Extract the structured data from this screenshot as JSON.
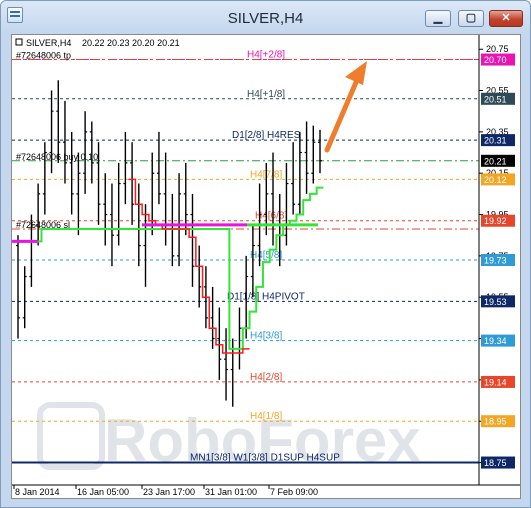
{
  "window": {
    "title": "SILVER,H4"
  },
  "chart_header": {
    "symbol": "SILVER,H4",
    "ohlc": "20.22 20.23 20.20 20.21"
  },
  "chart_data": {
    "type": "candlestick",
    "ylim": [
      18.68,
      20.78
    ],
    "y_ticks": [
      "20.75",
      "20.55",
      "20.35",
      "20.15",
      "19.95",
      "19.75",
      "19.55",
      "19.35",
      "19.15",
      "18.95",
      "18.75"
    ],
    "x_ticks": [
      "8 Jan 2014",
      "16 Jan 05:00",
      "23 Jan 17:00",
      "31 Jan 01:00",
      "7 Feb 09:00"
    ],
    "price_badges": [
      {
        "value": "20.70",
        "color": "#e815b2"
      },
      {
        "value": "20.51",
        "color": "#2e4a57"
      },
      {
        "value": "20.31",
        "color": "#0e2766"
      },
      {
        "value": "20.21",
        "color": "#000000"
      },
      {
        "value": "20.12",
        "color": "#f2a623"
      },
      {
        "value": "19.92",
        "color": "#e8462a"
      },
      {
        "value": "19.73",
        "color": "#2f9bd6"
      },
      {
        "value": "19.53",
        "color": "#0e2766"
      },
      {
        "value": "19.34",
        "color": "#2f9bd6"
      },
      {
        "value": "19.14",
        "color": "#e8462a"
      },
      {
        "value": "18.95",
        "color": "#f2a623"
      },
      {
        "value": "18.75",
        "color": "#0e2766"
      }
    ],
    "murrey_levels": [
      {
        "label": "H4[+2/8]",
        "price": 20.7,
        "color": "#e815b2"
      },
      {
        "label": "H4[+1/8]",
        "price": 20.51,
        "color": "#2e4a57"
      },
      {
        "label": "D1[2/8] H4RES",
        "price": 20.31,
        "color": "#0e2766"
      },
      {
        "label": "H4[7/8]",
        "price": 20.12,
        "color": "#f2a623"
      },
      {
        "label": "H4[6/8]",
        "price": 19.92,
        "color": "#e8462a"
      },
      {
        "label": "H4[5/8]",
        "price": 19.73,
        "color": "#2f9bd6"
      },
      {
        "label": "D1[1/8] H4PIVOT",
        "price": 19.53,
        "color": "#0e2766"
      },
      {
        "label": "H4[3/8]",
        "price": 19.34,
        "color": "#2f9bd6"
      },
      {
        "label": "H4[2/8]",
        "price": 19.14,
        "color": "#e8462a"
      },
      {
        "label": "H4[1/8]",
        "price": 18.95,
        "color": "#f2a623"
      },
      {
        "label": "MN1[3/8] W1[3/8] D1SUP H4SUP",
        "price": 18.75,
        "color": "#0e2766"
      }
    ],
    "trade_lines": [
      {
        "label": "#72648006 tp",
        "price": 20.7,
        "color": "#e8462a"
      },
      {
        "label": "#72648006 buy 0.10",
        "price": 20.21,
        "color": "#2c9c3c"
      },
      {
        "label": "#72648006 sl",
        "price": 19.88,
        "color": "#e8462a"
      }
    ],
    "candles": [
      [
        19.8,
        19.85,
        19.35,
        19.45
      ],
      [
        19.45,
        19.7,
        19.4,
        19.65
      ],
      [
        19.65,
        19.95,
        19.6,
        19.9
      ],
      [
        19.9,
        20.1,
        19.8,
        20.05
      ],
      [
        20.05,
        20.3,
        19.95,
        20.25
      ],
      [
        20.25,
        20.55,
        20.15,
        20.45
      ],
      [
        20.45,
        20.6,
        20.2,
        20.3
      ],
      [
        20.3,
        20.5,
        20.1,
        20.2
      ],
      [
        20.2,
        20.35,
        19.95,
        20.05
      ],
      [
        20.05,
        20.25,
        19.85,
        20.15
      ],
      [
        20.15,
        20.45,
        20.05,
        20.35
      ],
      [
        20.35,
        20.4,
        20.1,
        20.2
      ],
      [
        20.2,
        20.3,
        19.9,
        20.0
      ],
      [
        20.0,
        20.15,
        19.8,
        19.95
      ],
      [
        19.95,
        20.1,
        19.7,
        19.85
      ],
      [
        19.85,
        20.2,
        19.8,
        20.1
      ],
      [
        20.1,
        20.35,
        20.0,
        20.2
      ],
      [
        20.2,
        20.3,
        19.9,
        20.0
      ],
      [
        20.0,
        20.1,
        19.7,
        19.8
      ],
      [
        19.8,
        20.0,
        19.6,
        19.9
      ],
      [
        19.9,
        20.25,
        19.85,
        20.15
      ],
      [
        20.15,
        20.35,
        20.0,
        20.05
      ],
      [
        20.05,
        20.25,
        19.8,
        19.9
      ],
      [
        19.9,
        20.05,
        19.7,
        19.75
      ],
      [
        19.75,
        20.15,
        19.7,
        20.05
      ],
      [
        20.05,
        20.2,
        19.85,
        19.95
      ],
      [
        19.95,
        20.05,
        19.6,
        19.7
      ],
      [
        19.7,
        19.8,
        19.5,
        19.6
      ],
      [
        19.6,
        19.7,
        19.4,
        19.45
      ],
      [
        19.45,
        19.6,
        19.3,
        19.35
      ],
      [
        19.35,
        19.5,
        19.15,
        19.25
      ],
      [
        19.25,
        19.4,
        19.05,
        19.2
      ],
      [
        19.2,
        19.35,
        19.02,
        19.3
      ],
      [
        19.3,
        19.5,
        19.2,
        19.4
      ],
      [
        19.4,
        19.75,
        19.35,
        19.65
      ],
      [
        19.65,
        19.9,
        19.55,
        19.8
      ],
      [
        19.8,
        20.1,
        19.7,
        19.95
      ],
      [
        19.95,
        20.2,
        19.85,
        20.05
      ],
      [
        20.05,
        20.25,
        19.8,
        19.9
      ],
      [
        19.9,
        20.05,
        19.7,
        19.85
      ],
      [
        19.85,
        20.2,
        19.8,
        20.1
      ],
      [
        20.1,
        20.3,
        19.95,
        20.0
      ],
      [
        20.0,
        20.35,
        19.95,
        20.25
      ],
      [
        20.25,
        20.4,
        20.05,
        20.15
      ],
      [
        20.15,
        20.38,
        20.1,
        20.3
      ],
      [
        20.3,
        20.36,
        20.15,
        20.21
      ]
    ]
  },
  "watermark": "RoboForex"
}
